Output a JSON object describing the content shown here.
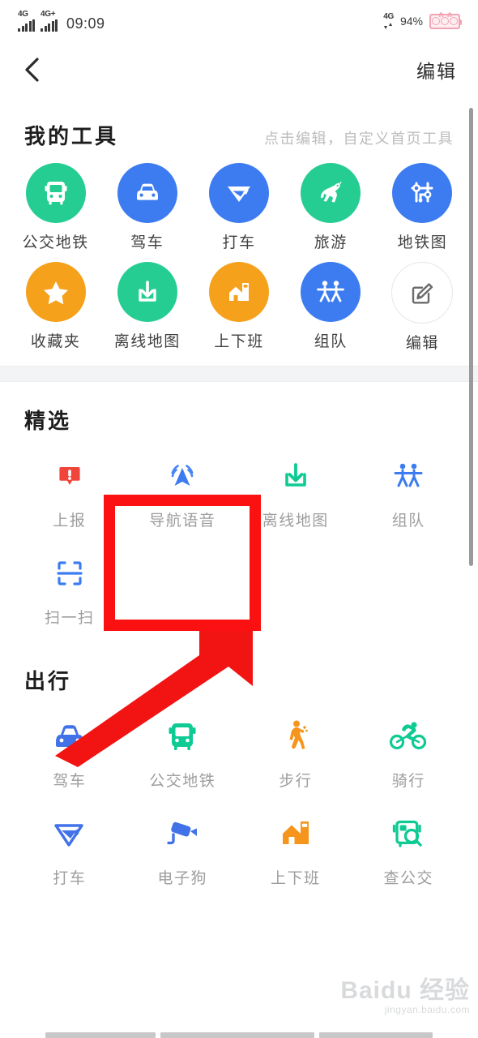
{
  "statusbar": {
    "network_left_1": "4G",
    "network_left_2": "4G+",
    "time": "09:09",
    "network_right": "4G",
    "battery_percent": "94%"
  },
  "navbar": {
    "back_icon": "chevron-left-icon",
    "edit_label": "编辑"
  },
  "colors": {
    "green": "#25cd93",
    "blue": "#3c7cf0",
    "blue_deep": "#3a6fe0",
    "orange": "#f5a11b",
    "red": "#f0453a",
    "annotation_red": "#fb1111",
    "outline_gray": "#e6e6e6",
    "label_gray": "#414141",
    "hint_gray": "#bcbcbc",
    "divider": "#f3f4f6"
  },
  "my_tools": {
    "title": "我的工具",
    "hint": "点击编辑，自定义首页工具",
    "items": [
      {
        "label": "公交地铁",
        "icon": "bus-icon",
        "style": "circle",
        "color": "#25cd93"
      },
      {
        "label": "驾车",
        "icon": "car-icon",
        "style": "circle",
        "color": "#3c7cf0"
      },
      {
        "label": "打车",
        "icon": "taxi-icon",
        "style": "circle",
        "color": "#3c7cf0"
      },
      {
        "label": "旅游",
        "icon": "horse-icon",
        "style": "circle",
        "color": "#25cd93"
      },
      {
        "label": "地铁图",
        "icon": "metro-map-icon",
        "style": "circle",
        "color": "#3c7cf0"
      },
      {
        "label": "收藏夹",
        "icon": "star-icon",
        "style": "circle",
        "color": "#f5a11b"
      },
      {
        "label": "离线地图",
        "icon": "download-icon",
        "style": "circle",
        "color": "#25cd93"
      },
      {
        "label": "上下班",
        "icon": "commute-icon",
        "style": "circle",
        "color": "#f5a11b"
      },
      {
        "label": "组队",
        "icon": "team-icon",
        "style": "circle",
        "color": "#3c7cf0"
      },
      {
        "label": "编辑",
        "icon": "edit-pencil-icon",
        "style": "outline",
        "color": "#6b6b6b"
      }
    ]
  },
  "featured": {
    "title": "精选",
    "items": [
      {
        "label": "上报",
        "icon": "report-alert-icon",
        "color": "#f0453a"
      },
      {
        "label": "导航语音",
        "icon": "navigation-voice-icon",
        "color": "#3c7cf0"
      },
      {
        "label": "离线地图",
        "icon": "download-icon",
        "color": "#25cd93"
      },
      {
        "label": "组队",
        "icon": "team-icon",
        "color": "#3c7cf0"
      },
      {
        "label": "扫一扫",
        "icon": "scan-icon",
        "color": "#3c7cf0"
      }
    ]
  },
  "travel": {
    "title": "出行",
    "items": [
      {
        "label": "驾车",
        "icon": "car-icon",
        "color": "#3c7cf0"
      },
      {
        "label": "公交地铁",
        "icon": "bus-icon",
        "color": "#25cd93"
      },
      {
        "label": "步行",
        "icon": "walk-icon",
        "color": "#f5a11b"
      },
      {
        "label": "骑行",
        "icon": "bike-icon",
        "color": "#25cd93"
      },
      {
        "label": "打车",
        "icon": "taxi-icon",
        "color": "#3c7cf0"
      },
      {
        "label": "电子狗",
        "icon": "speed-camera-icon",
        "color": "#3c7cf0"
      },
      {
        "label": "上下班",
        "icon": "commute-icon",
        "color": "#f5a11b"
      },
      {
        "label": "查公交",
        "icon": "bus-search-icon",
        "color": "#25cd93"
      }
    ]
  },
  "annotation": {
    "highlight_target": "导航语音",
    "arrow": "up-right-arrow"
  },
  "watermark": {
    "main": "Baidu 经验",
    "sub": "jingyan.baidu.com"
  }
}
